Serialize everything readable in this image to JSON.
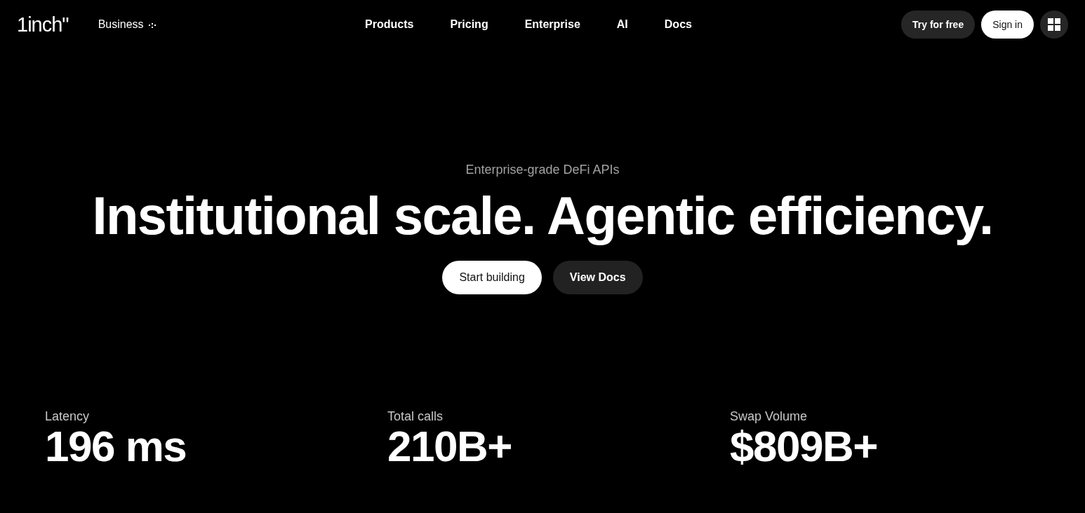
{
  "header": {
    "logo": "1inch\"",
    "context_menu": {
      "label": "Business"
    },
    "nav": [
      {
        "label": "Products"
      },
      {
        "label": "Pricing"
      },
      {
        "label": "Enterprise"
      },
      {
        "label": "AI"
      },
      {
        "label": "Docs"
      }
    ],
    "actions": [
      {
        "label": "Try for free",
        "kind": "secondary"
      },
      {
        "label": "Sign in",
        "kind": "primary"
      }
    ]
  },
  "hero": {
    "eyebrow": "Enterprise-grade DeFi APIs",
    "headline": "Institutional scale. Agentic efficiency.",
    "buttons": [
      {
        "label": "Start building",
        "kind": "primary"
      },
      {
        "label": "View Docs",
        "kind": "secondary"
      }
    ]
  },
  "stats": [
    {
      "label": "Latency",
      "value": "196 ms"
    },
    {
      "label": "Total calls",
      "value": "210B+"
    },
    {
      "label": "Swap Volume",
      "value": "$809B+"
    }
  ]
}
